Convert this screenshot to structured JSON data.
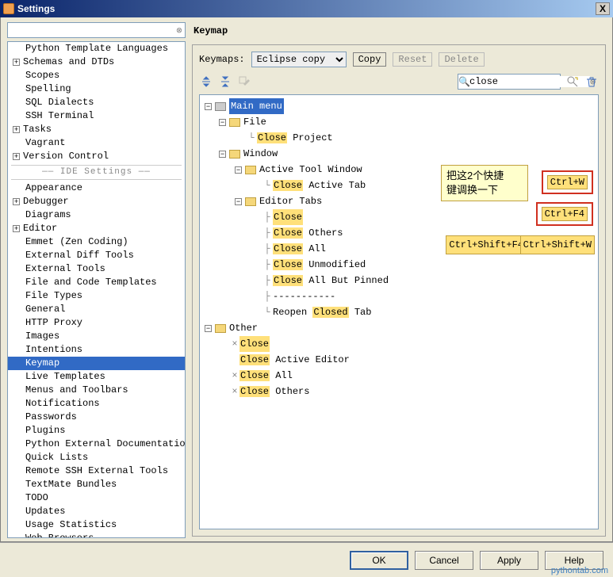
{
  "title": "Settings",
  "close_x": "X",
  "sidebar": {
    "search": "",
    "items": [
      {
        "label": "Python Template Languages",
        "indent": 2
      },
      {
        "label": "Schemas and DTDs",
        "indent": 1,
        "expander": "+"
      },
      {
        "label": "Scopes",
        "indent": 2
      },
      {
        "label": "Spelling",
        "indent": 2
      },
      {
        "label": "SQL Dialects",
        "indent": 2
      },
      {
        "label": "SSH Terminal",
        "indent": 2
      },
      {
        "label": "Tasks",
        "indent": 1,
        "expander": "+"
      },
      {
        "label": "Vagrant",
        "indent": 2
      },
      {
        "label": "Version Control",
        "indent": 1,
        "expander": "+"
      }
    ],
    "section_label": "IDE Settings",
    "ide_items": [
      {
        "label": "Appearance",
        "indent": 2
      },
      {
        "label": "Debugger",
        "indent": 1,
        "expander": "+"
      },
      {
        "label": "Diagrams",
        "indent": 2
      },
      {
        "label": "Editor",
        "indent": 1,
        "expander": "+"
      },
      {
        "label": "Emmet (Zen Coding)",
        "indent": 2
      },
      {
        "label": "External Diff Tools",
        "indent": 2
      },
      {
        "label": "External Tools",
        "indent": 2
      },
      {
        "label": "File and Code Templates",
        "indent": 2
      },
      {
        "label": "File Types",
        "indent": 2
      },
      {
        "label": "General",
        "indent": 2
      },
      {
        "label": "HTTP Proxy",
        "indent": 2
      },
      {
        "label": "Images",
        "indent": 2
      },
      {
        "label": "Intentions",
        "indent": 2
      },
      {
        "label": "Keymap",
        "indent": 2,
        "selected": true
      },
      {
        "label": "Live Templates",
        "indent": 2
      },
      {
        "label": "Menus and Toolbars",
        "indent": 2
      },
      {
        "label": "Notifications",
        "indent": 2
      },
      {
        "label": "Passwords",
        "indent": 2
      },
      {
        "label": "Plugins",
        "indent": 2
      },
      {
        "label": "Python External Documentation",
        "indent": 2
      },
      {
        "label": "Quick Lists",
        "indent": 2
      },
      {
        "label": "Remote SSH External Tools",
        "indent": 2
      },
      {
        "label": "TextMate Bundles",
        "indent": 2
      },
      {
        "label": "TODO",
        "indent": 2
      },
      {
        "label": "Updates",
        "indent": 2
      },
      {
        "label": "Usage Statistics",
        "indent": 2
      },
      {
        "label": "Web Browsers",
        "indent": 2
      }
    ]
  },
  "panel": {
    "title": "Keymap",
    "keymaps_label": "Keymaps:",
    "keymap_selected": "Eclipse copy",
    "copy_btn": "Copy",
    "reset_btn": "Reset",
    "delete_btn": "Delete",
    "filter_value": "close",
    "tree": {
      "main_menu": "Main menu",
      "file": "File",
      "close_project_hl": "Close",
      "close_project_rest": " Project",
      "window": "Window",
      "active_tool_window": "Active Tool Window",
      "close_active_tab_hl": "Close",
      "close_active_tab_rest": " Active Tab",
      "editor_tabs": "Editor Tabs",
      "close": "Close",
      "close_others_hl": "Close",
      "close_others_rest": " Others",
      "close_all_hl": "Close",
      "close_all_rest": " All",
      "close_unmod_hl": "Close",
      "close_unmod_rest": " Unmodified",
      "close_allbut_hl": "Close",
      "close_allbut_rest": " All But Pinned",
      "dashes": "-----------",
      "reopen_pre": "Reopen ",
      "reopen_hl": "Closed",
      "reopen_post": " Tab",
      "other": "Other",
      "o_close": "Close",
      "o_close_editor_hl": "Close",
      "o_close_editor_rest": " Active Editor",
      "o_close_all_hl": "Close",
      "o_close_all_rest": " All",
      "o_close_others_hl": "Close",
      "o_close_others_rest": " Others"
    },
    "shortcuts": {
      "ctrl_w": "Ctrl+W",
      "ctrl_f4": "Ctrl+F4",
      "ctrl_shift_f4": "Ctrl+Shift+F4",
      "ctrl_shift_w": "Ctrl+Shift+W"
    },
    "annotation": "把这2个快捷\n键调换一下"
  },
  "buttons": {
    "ok": "OK",
    "cancel": "Cancel",
    "apply": "Apply",
    "help": "Help"
  },
  "watermark": "pythontab.com"
}
